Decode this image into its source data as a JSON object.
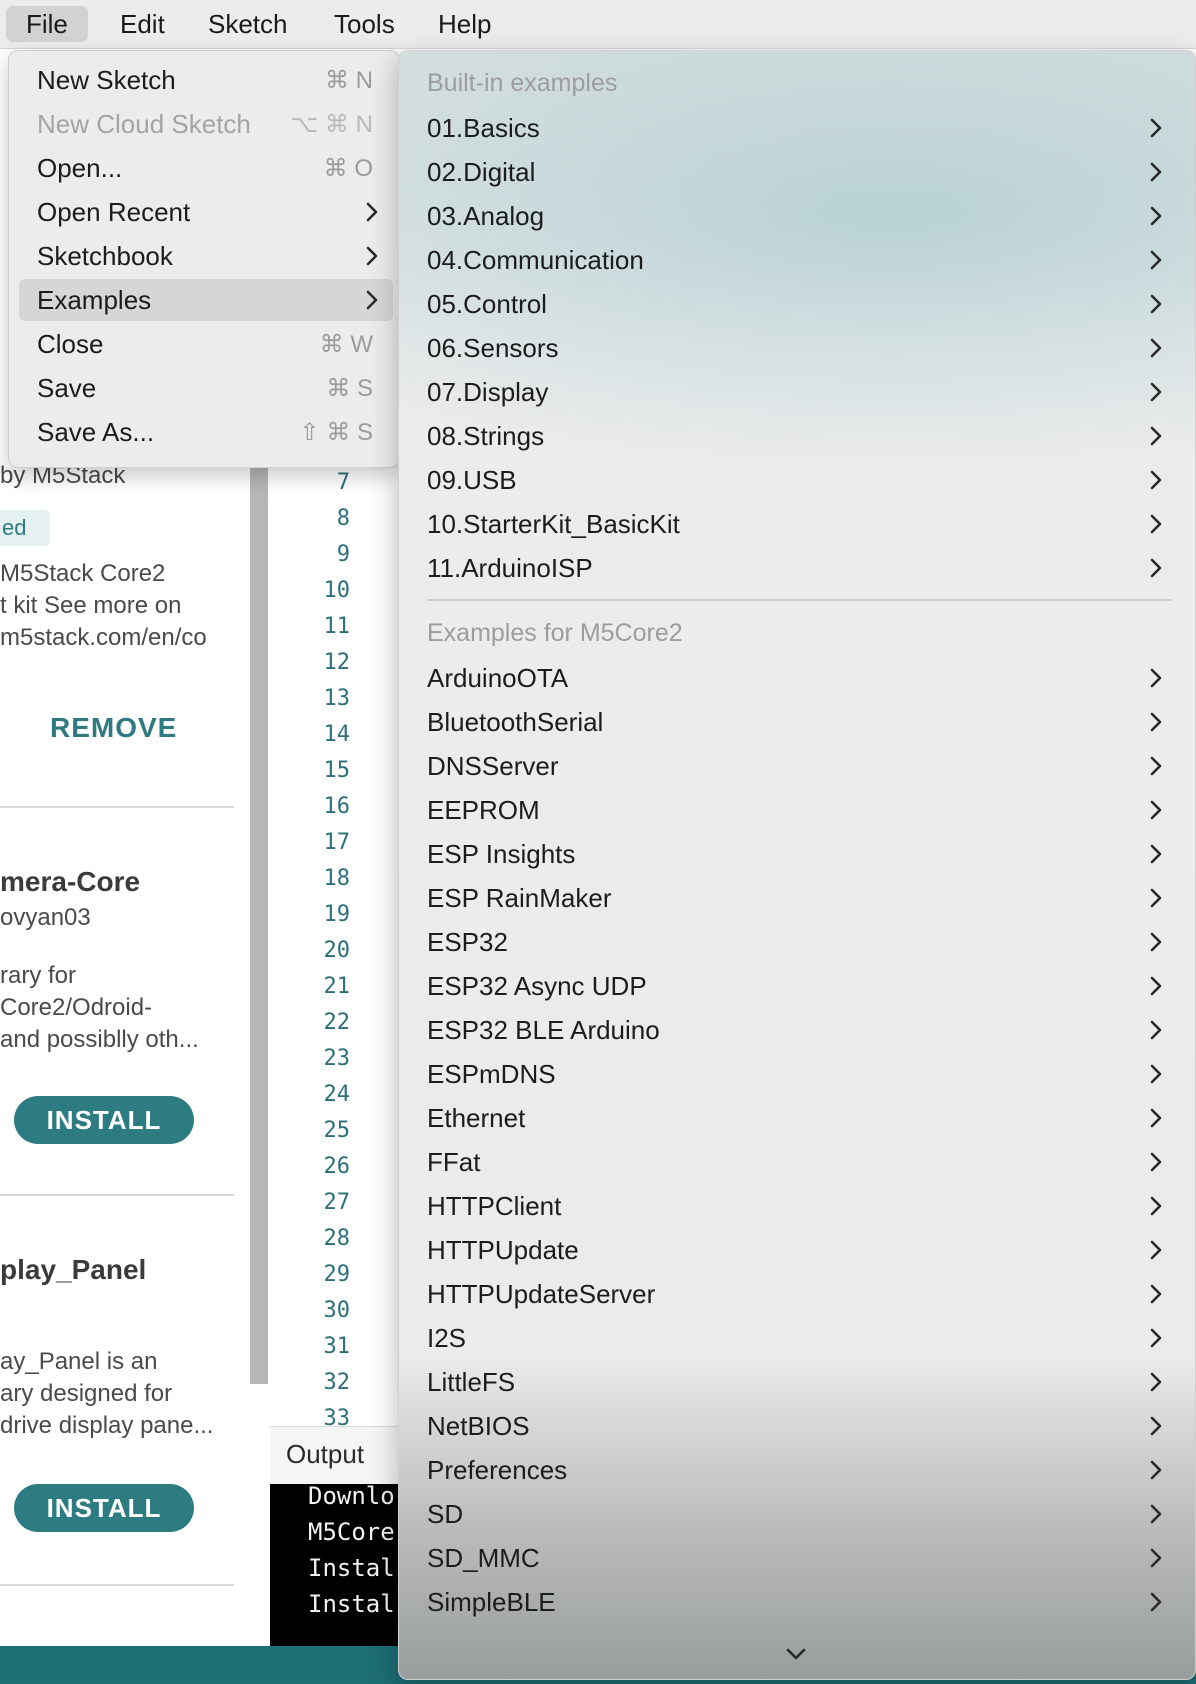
{
  "menubar": {
    "items": [
      "File",
      "Edit",
      "Sketch",
      "Tools",
      "Help"
    ],
    "active": "File"
  },
  "library_panel": {
    "entries": [
      {
        "author": "by M5Stack",
        "badge": "ed",
        "desc": [
          "M5Stack Core2",
          "t kit See more on",
          "m5stack.com/en/co"
        ],
        "button": "REMOVE"
      },
      {
        "title": "mera-Core",
        "author": "ovyan03",
        "desc": [
          "rary for",
          "Core2/Odroid-",
          "and possiblly oth..."
        ],
        "button": "INSTALL"
      },
      {
        "title": "play_Panel",
        "desc": [
          "ay_Panel is an",
          "ary designed for",
          "drive display pane..."
        ],
        "button": "INSTALL"
      }
    ]
  },
  "editor": {
    "line_numbers": [
      "7",
      "8",
      "9",
      "10",
      "11",
      "12",
      "13",
      "14",
      "15",
      "16",
      "17",
      "18",
      "19",
      "20",
      "21",
      "22",
      "23",
      "24",
      "25",
      "26",
      "27",
      "28",
      "29",
      "30",
      "31",
      "32",
      "33"
    ]
  },
  "output": {
    "label": "Output",
    "lines": [
      "Downlo",
      "M5Core",
      "Instal",
      "Instal"
    ]
  },
  "file_menu": {
    "items": [
      {
        "label": "New Sketch",
        "shortcut": "⌘ N",
        "disabled": false,
        "submenu": false
      },
      {
        "label": "New Cloud Sketch",
        "shortcut": "⌥ ⌘ N",
        "disabled": true,
        "submenu": false
      },
      {
        "label": "Open...",
        "shortcut": "⌘ O",
        "disabled": false,
        "submenu": false
      },
      {
        "label": "Open Recent",
        "shortcut": "",
        "disabled": false,
        "submenu": true
      },
      {
        "label": "Sketchbook",
        "shortcut": "",
        "disabled": false,
        "submenu": true
      },
      {
        "label": "Examples",
        "shortcut": "",
        "disabled": false,
        "submenu": true,
        "highlighted": true
      },
      {
        "label": "Close",
        "shortcut": "⌘ W",
        "disabled": false,
        "submenu": false
      },
      {
        "label": "Save",
        "shortcut": "⌘ S",
        "disabled": false,
        "submenu": false
      },
      {
        "label": "Save As...",
        "shortcut": "⇧ ⌘ S",
        "disabled": false,
        "submenu": false
      }
    ]
  },
  "examples_menu": {
    "builtin_header": "Built-in examples",
    "builtin": [
      "01.Basics",
      "02.Digital",
      "03.Analog",
      "04.Communication",
      "05.Control",
      "06.Sensors",
      "07.Display",
      "08.Strings",
      "09.USB",
      "10.StarterKit_BasicKit",
      "11.ArduinoISP"
    ],
    "board_header": "Examples for M5Core2",
    "board": [
      "ArduinoOTA",
      "BluetoothSerial",
      "DNSServer",
      "EEPROM",
      "ESP Insights",
      "ESP RainMaker",
      "ESP32",
      "ESP32 Async UDP",
      "ESP32 BLE Arduino",
      "ESPmDNS",
      "Ethernet",
      "FFat",
      "HTTPClient",
      "HTTPUpdate",
      "HTTPUpdateServer",
      "I2S",
      "LittleFS",
      "NetBIOS",
      "Preferences",
      "SD",
      "SD_MMC",
      "SimpleBLE"
    ],
    "more_indicator": "chevron-down-icon"
  },
  "colors": {
    "accent": "#2c7c82",
    "status_bar": "#1d6e75",
    "line_numbers": "#2d6f7a",
    "menu_bg": "#ececec"
  }
}
